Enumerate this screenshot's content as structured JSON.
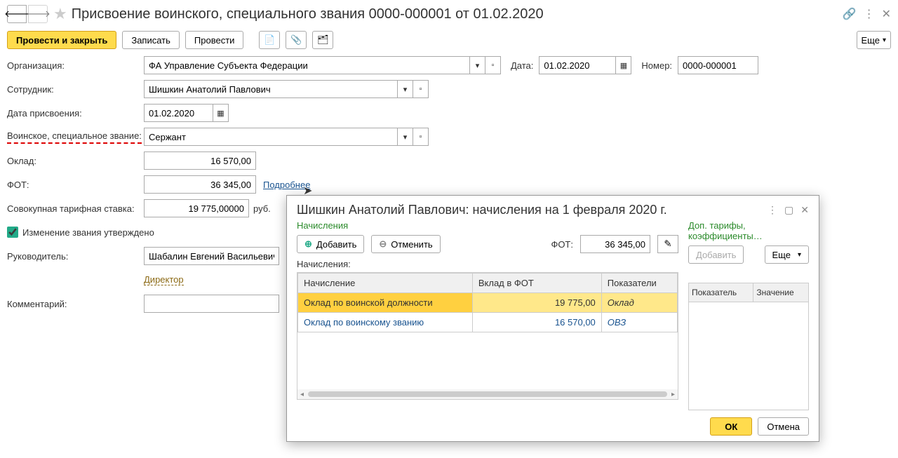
{
  "header": {
    "title": "Присвоение воинского, специального звания 0000-000001 от 01.02.2020"
  },
  "toolbar": {
    "post_close": "Провести и закрыть",
    "save": "Записать",
    "post": "Провести",
    "more": "Еще"
  },
  "form": {
    "org_label": "Организация:",
    "org_value": "ФА Управление Субъекта Федерации",
    "date_label": "Дата:",
    "date_value": "01.02.2020",
    "number_label": "Номер:",
    "number_value": "0000-000001",
    "employee_label": "Сотрудник:",
    "employee_value": "Шишкин Анатолий Павлович",
    "assign_date_label": "Дата присвоения:",
    "assign_date_value": "01.02.2020",
    "rank_label": "Воинское, специальное звание:",
    "rank_value": "Сержант",
    "salary_label": "Оклад:",
    "salary_value": "16 570,00",
    "fot_label": "ФОТ:",
    "fot_value": "36 345,00",
    "details_link": "Подробнее",
    "tariff_label": "Совокупная тарифная ставка:",
    "tariff_value": "19 775,00000",
    "tariff_unit": "руб.",
    "approved_label": "Изменение звания утверждено",
    "manager_label": "Руководитель:",
    "manager_value": "Шабалин Евгений Васильевич",
    "manager_pos": "Директор",
    "comment_label": "Комментарий:",
    "comment_value": ""
  },
  "popup": {
    "title": "Шишкин Анатолий Павлович: начисления на 1 февраля 2020 г.",
    "accruals_label": "Начисления",
    "add_btn": "Добавить",
    "cancel_btn": "Отменить",
    "fot_label": "ФОТ:",
    "fot_value": "36 345,00",
    "sub_label": "Начисления:",
    "extra_label": "Доп. тарифы, коэффициенты…",
    "add2_btn": "Добавить",
    "more_btn": "Еще",
    "table": {
      "headers": [
        "Начисление",
        "Вклад в ФОТ",
        "Показатели"
      ],
      "rows": [
        {
          "name": "Оклад по воинской должности",
          "fot": "19 775,00",
          "ind": "Оклад",
          "selected": true
        },
        {
          "name": "Оклад по воинскому званию",
          "fot": "16 570,00",
          "ind": "ОВЗ",
          "selected": false
        }
      ]
    },
    "right_table": {
      "headers": [
        "Показатель",
        "Значение"
      ]
    },
    "ok": "ОК",
    "cancel": "Отмена"
  }
}
